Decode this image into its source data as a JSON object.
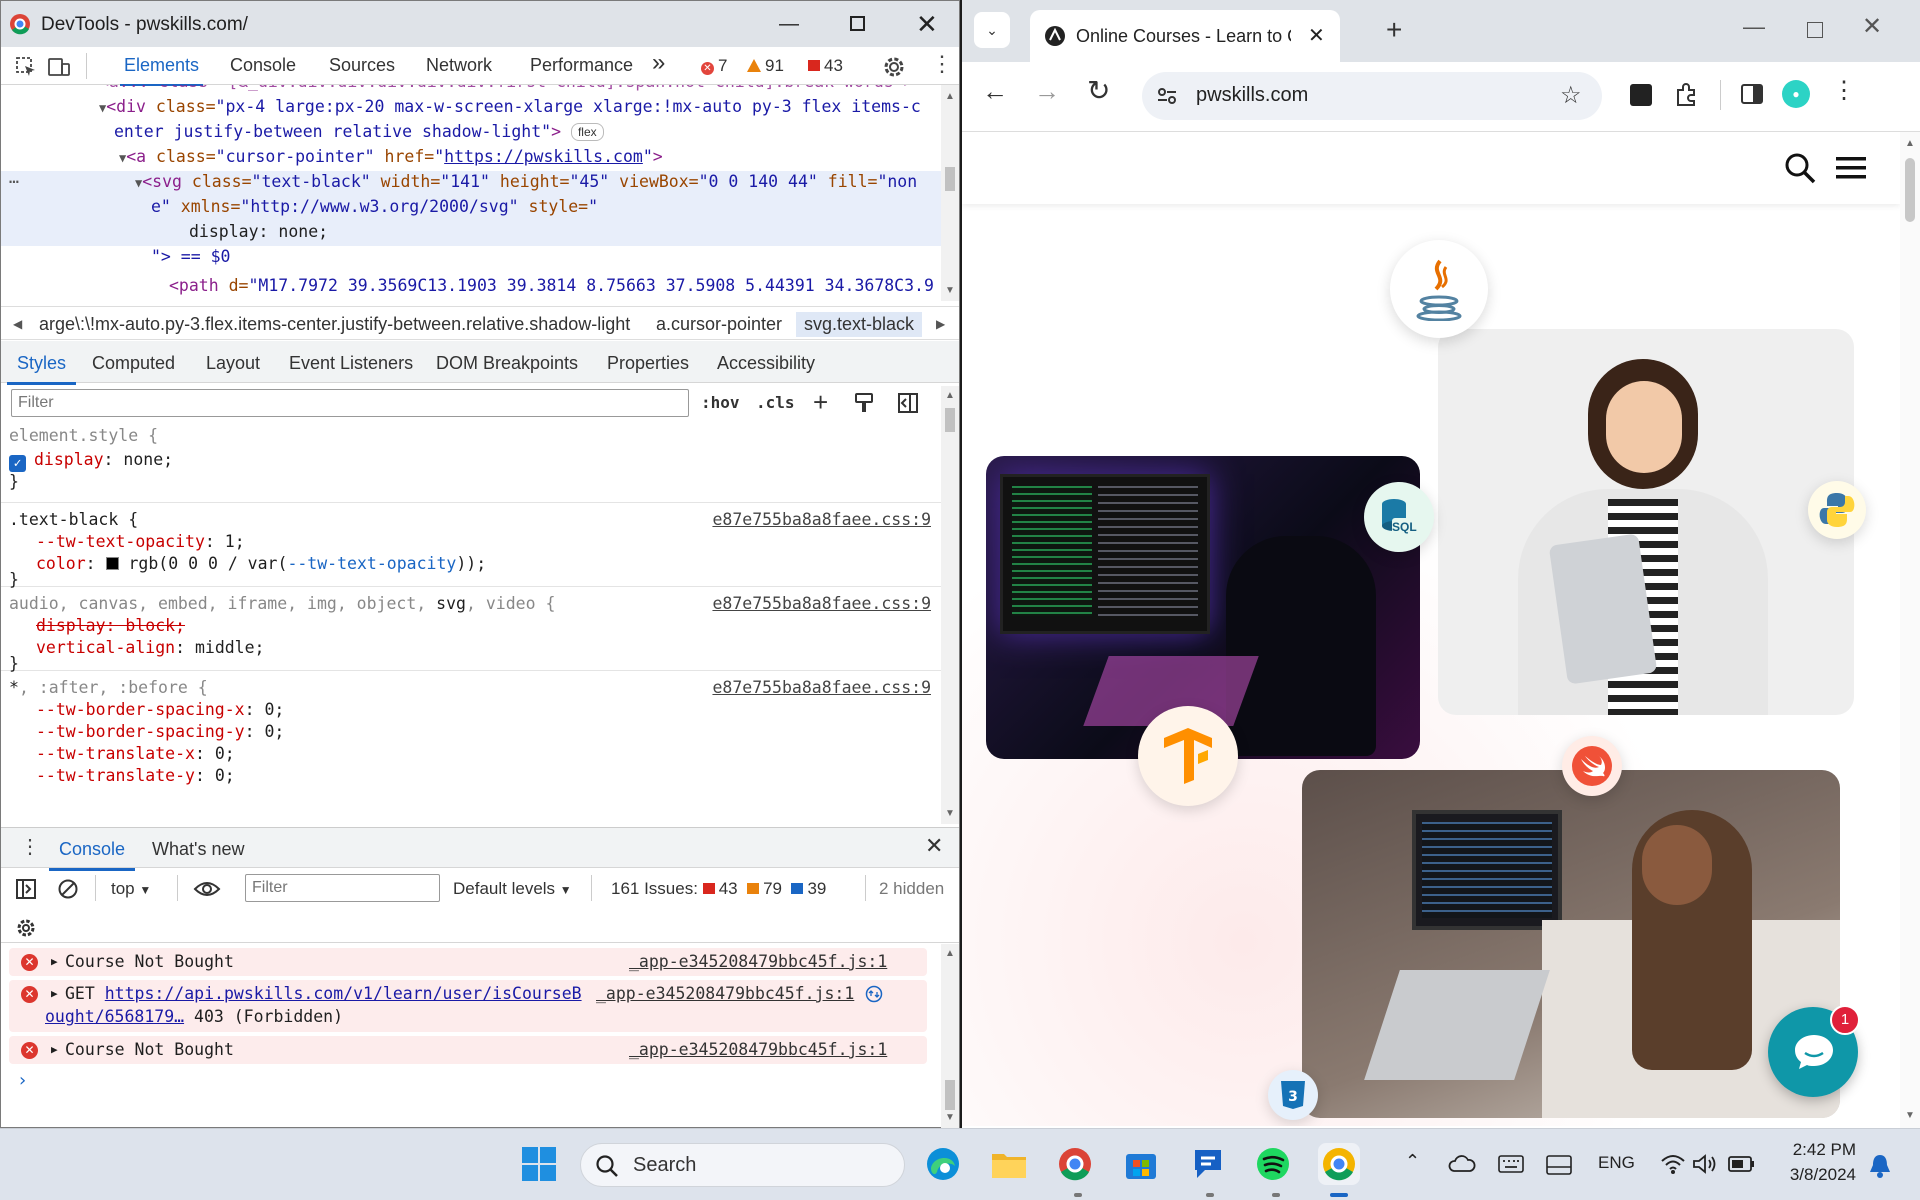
{
  "devtools": {
    "window_title": "DevTools - pwskills.com/",
    "tabs": [
      "Elements",
      "Console",
      "Sources",
      "Network",
      "Performance"
    ],
    "more_tabs": "»",
    "errors_count": "7",
    "warnings_count": "91",
    "issues_count": "43",
    "dom": {
      "line0": "<a... class=\"[&_div:div:div:div:div:div:first-child]:span:not-child]:break-words\">",
      "line1_tag": "<div",
      "line1_attr": " class=",
      "line1_val": "\"px-4 large:px-20 max-w-screen-xlarge xlarge:!mx-auto py-3 flex items-c",
      "line2_val": "enter justify-between relative shadow-light\"",
      "line2_end": ">",
      "flex_chip": "flex",
      "line3_tag": "<a",
      "line3_attr1": " class=",
      "line3_val1": "\"cursor-pointer\"",
      "line3_attr2": " href=",
      "line3_link": "https://pwskills.com",
      "line3_end": ">",
      "line4_tag": "<svg",
      "line4_attr1": " class=",
      "line4_val1": "\"text-black\"",
      "line4_attr2": " width=",
      "line4_val2": "\"141\"",
      "line4_attr3": " height=",
      "line4_val3": "\"45\"",
      "line4_attr4": " viewBox=",
      "line4_val4": "\"0 0 140 44\"",
      "line4_attr5": " fill=",
      "line4_val5": "\"non",
      "line5_val": "e\"",
      "line5_attr": " xmlns=",
      "line5_val2": "\"http://www.w3.org/2000/svg\"",
      "line5_attr2": " style=",
      "line5_val3": "\"",
      "line6": "display: none;",
      "line7": "\"> == $0",
      "line8_tag": "<path",
      "line8_attr": " d=",
      "line8_val": "\"M17.7972 39.3569C13.1903 39.3814 8.75663 37.5908 5.44391 34.3678C3.9"
    },
    "breadcrumbs": [
      "arge\\:\\!mx-auto.py-3.flex.items-center.justify-between.relative.shadow-light",
      "a.cursor-pointer",
      "svg.text-black"
    ],
    "subtabs": [
      "Styles",
      "Computed",
      "Layout",
      "Event Listeners",
      "DOM Breakpoints",
      "Properties",
      "Accessibility"
    ],
    "styles_filter_placeholder": "Filter",
    "hov": ":hov",
    "cls": ".cls",
    "rules": {
      "r1_selector": "element.style {",
      "r1_prop": "display",
      "r1_val": " none;",
      "r2_selector": ".text-black {",
      "r2_src": "e87e755ba8a8faee.css:9",
      "r2_p1": "--tw-text-opacity",
      "r2_v1": " 1;",
      "r2_p2": "color",
      "r2_v2a": " rgb(0 0 0 / var(",
      "r2_v2b": "--tw-text-opacity",
      "r2_v2c": "));",
      "r3_sel_dim": "audio, canvas, embed, iframe, img, object, ",
      "r3_sel_main": "svg",
      "r3_sel_dim2": ", video {",
      "r3_src": "e87e755ba8a8faee.css:9",
      "r3_p1": "display: block;",
      "r3_p2": "vertical-align",
      "r3_v2": " middle;",
      "r4_sel_main": "*",
      "r4_sel_dim": ", :after, :before {",
      "r4_src": "e87e755ba8a8faee.css:9",
      "r4_p1": "--tw-border-spacing-x",
      "r4_p2": "--tw-border-spacing-y",
      "r4_p3": "--tw-translate-x",
      "r4_p4": "--tw-translate-y",
      "r4_v": " 0;",
      "close_brace": "}"
    },
    "drawer": {
      "tab_console": "Console",
      "tab_whatsnew": "What's new",
      "context": "top",
      "filter_placeholder": "Filter",
      "levels": "Default levels",
      "issues_label": "161 Issues:",
      "issues_err": "43",
      "issues_warn": "79",
      "issues_info": "39",
      "hidden": "2 hidden",
      "msg1": "Course Not Bought",
      "msg1_src": "_app-e345208479bbc45f.js:1",
      "msg2_prefix": "GET ",
      "msg2_link1": "https://api.pwskills.com/v1/learn/user/isCourseB",
      "msg2_src": "_app-e345208479bbc45f.js:1",
      "msg2_link2": "ought/6568179…",
      "msg2_status": " 403 (Forbidden)",
      "msg3": "Course Not Bought",
      "msg3_src": "_app-e345208479bbc45f.js:1"
    }
  },
  "browser": {
    "tab_title": "Online Courses - Learn to Code",
    "url": "pwskills.com",
    "chat_badge": "1",
    "sql_label": "SQL"
  },
  "taskbar": {
    "search_placeholder": "Search",
    "lang": "ENG",
    "time": "2:42 PM",
    "date": "3/8/2024"
  }
}
